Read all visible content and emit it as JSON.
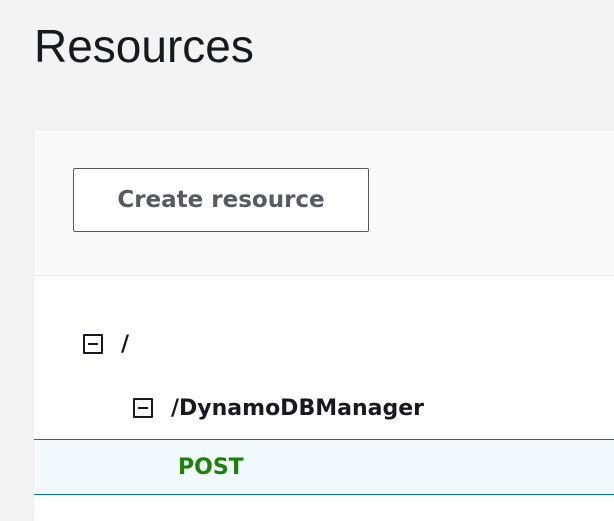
{
  "page": {
    "title": "Resources"
  },
  "toolbar": {
    "create_resource_label": "Create resource"
  },
  "tree": {
    "root": {
      "path": "/",
      "expanded": true,
      "icon": "collapse-icon"
    },
    "children": [
      {
        "path": "/DynamoDBManager",
        "expanded": true,
        "icon": "collapse-icon",
        "methods": [
          {
            "label": "POST",
            "selected": true,
            "color": "#1d8102"
          }
        ]
      }
    ]
  },
  "colors": {
    "page_background": "#f2f3f3",
    "selection_border": "#0073bb",
    "selection_background": "#f1faff",
    "method_post": "#1d8102"
  }
}
